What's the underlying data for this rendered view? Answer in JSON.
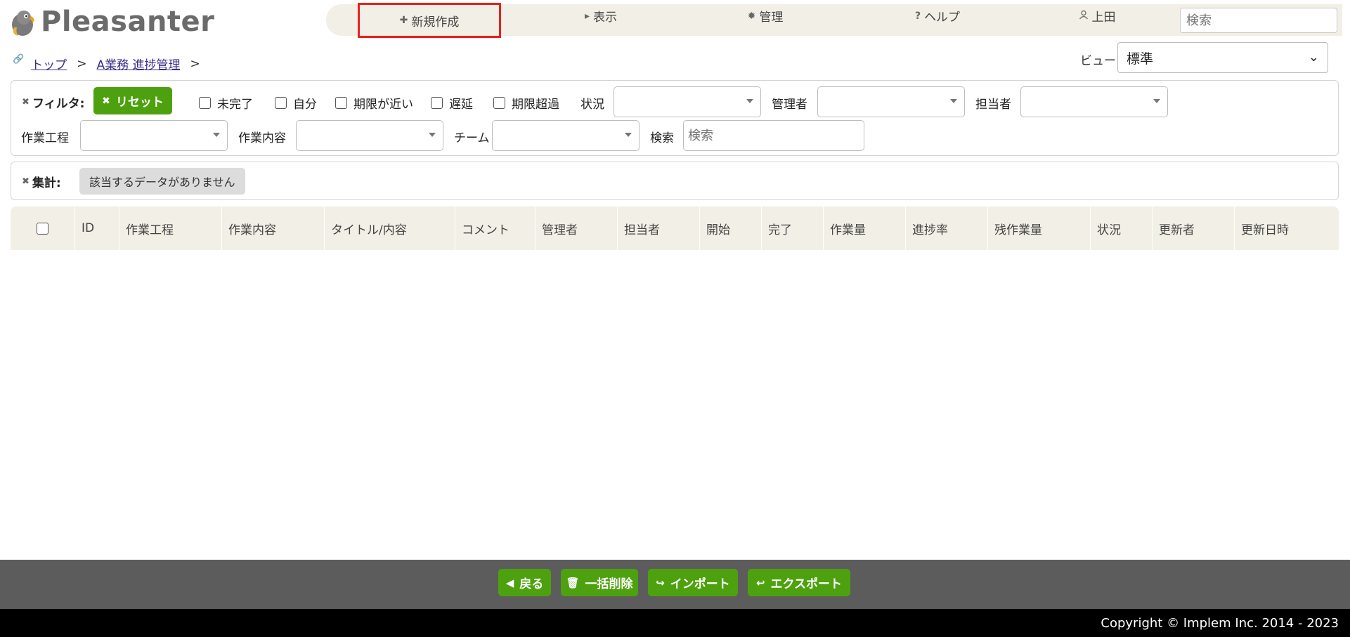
{
  "header": {
    "logo_text": "Pleasanter",
    "nav": {
      "new": "新規作成",
      "view": "表示",
      "admin": "管理",
      "help": "ヘルプ",
      "user": "上田"
    },
    "search_placeholder": "検索"
  },
  "breadcrumb": {
    "top": "トップ",
    "site": "A業務 進捗管理",
    "separator": ">"
  },
  "view": {
    "label": "ビュー",
    "selected": "標準"
  },
  "filter": {
    "title": "フィルタ:",
    "reset": "リセット",
    "checks": [
      "未完了",
      "自分",
      "期限が近い",
      "遅延",
      "期限超過"
    ],
    "status_label": "状況",
    "manager_label": "管理者",
    "owner_label": "担当者",
    "process_label": "作業工程",
    "content_label": "作業内容",
    "team_label": "チーム",
    "search_label": "検索",
    "search_placeholder": "検索"
  },
  "aggregation": {
    "title": "集計:",
    "no_data": "該当するデータがありません"
  },
  "table": {
    "columns": [
      "ID",
      "作業工程",
      "作業内容",
      "タイトル/内容",
      "コメント",
      "管理者",
      "担当者",
      "開始",
      "完了",
      "作業量",
      "進捗率",
      "残作業量",
      "状況",
      "更新者",
      "更新日時"
    ]
  },
  "footer": {
    "back": "戻る",
    "bulk_delete": "一括削除",
    "import": "インポート",
    "export": "エクスポート",
    "copyright": "Copyright © Implem Inc. 2014 - 2023"
  },
  "colors": {
    "accent_green": "#4ea10e",
    "nav_bg": "#f2efe6",
    "highlight_red": "#e8211c"
  }
}
